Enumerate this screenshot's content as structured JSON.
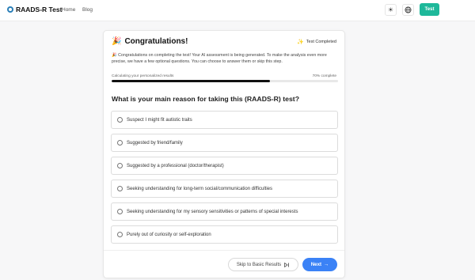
{
  "header": {
    "logo_text": "RAADS-R Test",
    "nav": [
      "Home",
      "Blog"
    ],
    "theme_icon": "sun-icon",
    "language_icon": "globe-icon",
    "cta_label": "Test"
  },
  "card": {
    "title_icon": "party-popper-icon",
    "title": "Congratulations!",
    "status_icon": "sparkle-icon",
    "status": "Test Completed",
    "intro_icon": "party-popper-icon",
    "intro": "Congratulations on completing the test! Your AI assessment is being generated. To make the analysis even more precise, we have a few optional questions. You can choose to answer them or skip this step.",
    "progress": {
      "label": "Calculating your personalized results",
      "percent_label": "70% complete",
      "percent": 70
    },
    "question": "What is your main reason for taking this (RAADS-R) test?",
    "options": [
      "Suspect I might fit autistic traits",
      "Suggested by friend/family",
      "Suggested by a professional (doctor/therapist)",
      "Seeking understanding for long-term social/communication difficulties",
      "Seeking understanding for my sensory sensitivities or patterns of special interests",
      "Purely out of curiosity or self-exploration"
    ],
    "skip_label": "Skip to Basic Results",
    "skip_icon": "skip-forward-icon",
    "next_label": "Next",
    "next_icon": "arrow-right-icon"
  },
  "colors": {
    "accent_teal": "#1eb89a",
    "accent_blue": "#3b82f6",
    "progress_fill": "#111111"
  }
}
